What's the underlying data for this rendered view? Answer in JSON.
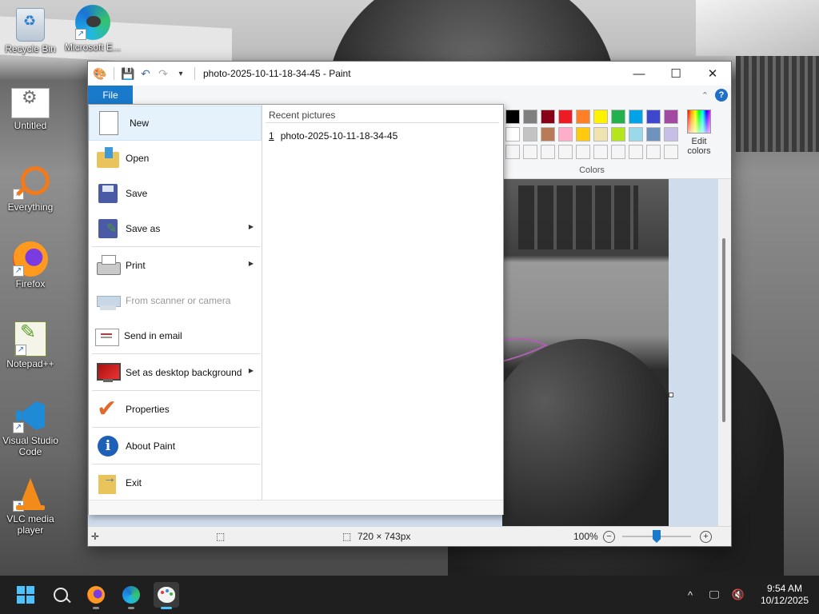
{
  "desktop": {
    "icons": [
      {
        "label": "Recycle Bin",
        "icon": "recycle-bin-icon"
      },
      {
        "label": "Microsoft E...",
        "icon": "edge-icon"
      },
      {
        "label": "Untitled",
        "icon": "untitled-file-icon"
      },
      {
        "label": "Everything",
        "icon": "everything-search-icon"
      },
      {
        "label": "Firefox",
        "icon": "firefox-icon"
      },
      {
        "label": "Notepad++",
        "icon": "notepadpp-icon"
      },
      {
        "label": "Visual Studio Code",
        "icon": "vscode-icon"
      },
      {
        "label": "VLC media player",
        "icon": "vlc-icon"
      }
    ]
  },
  "window": {
    "title": "photo-2025-10-11-18-34-45 - Paint",
    "controls": {
      "minimize": "—",
      "maximize": "☐",
      "close": "✕"
    }
  },
  "ribbon": {
    "file_tab": "File",
    "colors_label": "Colors",
    "edit_colors": "Edit colors",
    "palette_row1": [
      "#000000",
      "#7f7f7f",
      "#880015",
      "#ed1c24",
      "#ff7f27",
      "#fff200",
      "#22b14c",
      "#00a2e8",
      "#3f48cc",
      "#a349a4"
    ],
    "palette_row2": [
      "#ffffff",
      "#c3c3c3",
      "#b97a57",
      "#ffaec9",
      "#ffc90e",
      "#efe4b0",
      "#b5e61d",
      "#99d9ea",
      "#7092be",
      "#c8bfe7"
    ],
    "palette_row3": [
      "#f5f5f5",
      "#f5f5f5",
      "#f5f5f5",
      "#f5f5f5",
      "#f5f5f5",
      "#f5f5f5",
      "#f5f5f5",
      "#f5f5f5",
      "#f5f5f5",
      "#f5f5f5"
    ]
  },
  "file_menu": {
    "items": [
      {
        "label": "New",
        "icon": "new-file-icon",
        "submenu": false,
        "disabled": false
      },
      {
        "label": "Open",
        "icon": "open-folder-icon",
        "submenu": false,
        "disabled": false
      },
      {
        "label": "Save",
        "icon": "save-icon",
        "submenu": false,
        "disabled": false
      },
      {
        "label": "Save as",
        "icon": "save-as-icon",
        "submenu": true,
        "disabled": false
      },
      {
        "label": "Print",
        "icon": "printer-icon",
        "submenu": true,
        "disabled": false
      },
      {
        "label": "From scanner or camera",
        "icon": "scanner-icon",
        "submenu": false,
        "disabled": true
      },
      {
        "label": "Send in email",
        "icon": "email-icon",
        "submenu": false,
        "disabled": false
      },
      {
        "label": "Set as desktop background",
        "icon": "desktop-background-icon",
        "submenu": true,
        "disabled": false
      },
      {
        "label": "Properties",
        "icon": "properties-checkmark-icon",
        "submenu": false,
        "disabled": false
      },
      {
        "label": "About Paint",
        "icon": "info-icon",
        "submenu": false,
        "disabled": false
      },
      {
        "label": "Exit",
        "icon": "exit-icon",
        "submenu": false,
        "disabled": false
      }
    ],
    "recent_heading": "Recent pictures",
    "recent": [
      {
        "num": "1",
        "name": "photo-2025-10-11-18-34-45"
      }
    ]
  },
  "statusbar": {
    "move_icon": "✛",
    "selection_icon": "⬚",
    "dimensions": "720 × 743px",
    "zoom": "100%",
    "zoom_out": "−",
    "zoom_in": "+",
    "zoom_level": 0.5
  },
  "taskbar": {
    "apps": [
      "start-button",
      "search-button",
      "firefox",
      "edge",
      "paint"
    ],
    "time": "9:54 AM",
    "date": "10/12/2025",
    "tray_chevron": "^"
  }
}
